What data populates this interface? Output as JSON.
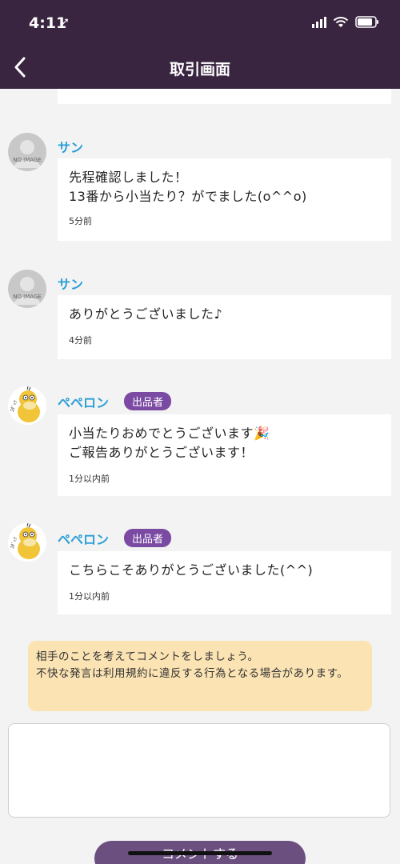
{
  "status": {
    "time": "4:11"
  },
  "nav": {
    "title": "取引画面"
  },
  "messages": [
    {
      "user": "サン",
      "avatar_label": "NO IMAGE",
      "text": "先程確認しました！\n13番から小当たり？がでました(o^^o)",
      "time": "5分前"
    },
    {
      "user": "サン",
      "avatar_label": "NO IMAGE",
      "text": "ありがとうございました♪",
      "time": "4分前"
    },
    {
      "user": "ペペロン",
      "badge": "出品者",
      "text": "小当たりおめでとうございます🎉\nご報告ありがとうございます！",
      "time": "1分以内前"
    },
    {
      "user": "ペペロン",
      "badge": "出品者",
      "text": "こちらこそありがとうございました(^^)",
      "time": "1分以内前"
    }
  ],
  "notice": {
    "text": "相手のことを考えてコメントをしましょう。\n不快な発言は利用規約に違反する行為となる場合があります。"
  },
  "comment": {
    "value": "",
    "submit_label": "コメントする"
  },
  "colors": {
    "header": "#3a2541",
    "username": "#2a9fd6",
    "badge": "#7b4aa3",
    "notice_bg": "#fbe3b3"
  },
  "icons": {
    "back": "chevron-left-icon",
    "signal": "cellular-signal-icon",
    "wifi": "wifi-icon",
    "battery": "battery-icon"
  }
}
